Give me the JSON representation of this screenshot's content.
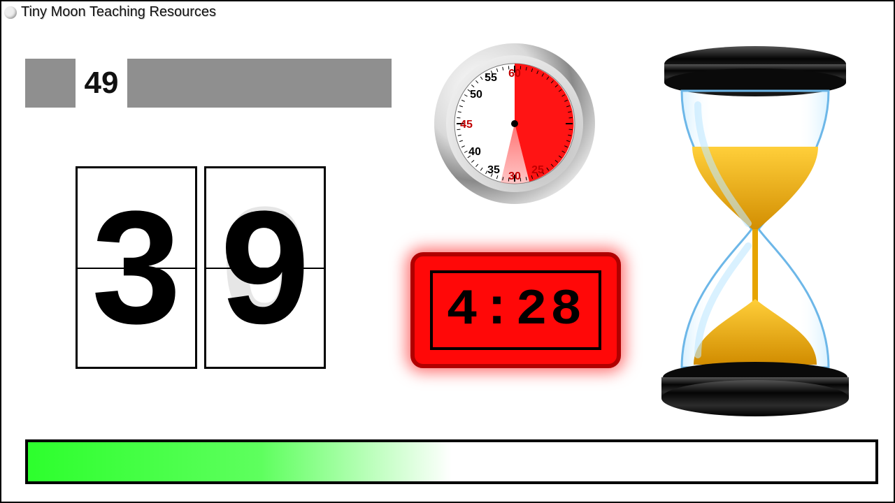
{
  "header": {
    "title": "Tiny Moon Teaching Resources"
  },
  "number_strip": {
    "value": "49"
  },
  "flip_clock": {
    "digits": [
      "3",
      "9"
    ],
    "ghost_digits": [
      "",
      "0"
    ]
  },
  "stopwatch": {
    "labels": [
      "55",
      "60",
      "45",
      "40",
      "35",
      "30",
      "25",
      "50"
    ],
    "highlight_labels": [
      "60",
      "45",
      "30",
      "25"
    ],
    "elapsed_fraction": 0.46
  },
  "digital_timer": {
    "display": "4:28",
    "bg_color": "#ff0808"
  },
  "hourglass": {
    "sand_remaining_fraction": 0.35,
    "sand_color": "#e6a400"
  },
  "progress_bar": {
    "percent": 50,
    "fill_color_start": "#2dff2d"
  }
}
